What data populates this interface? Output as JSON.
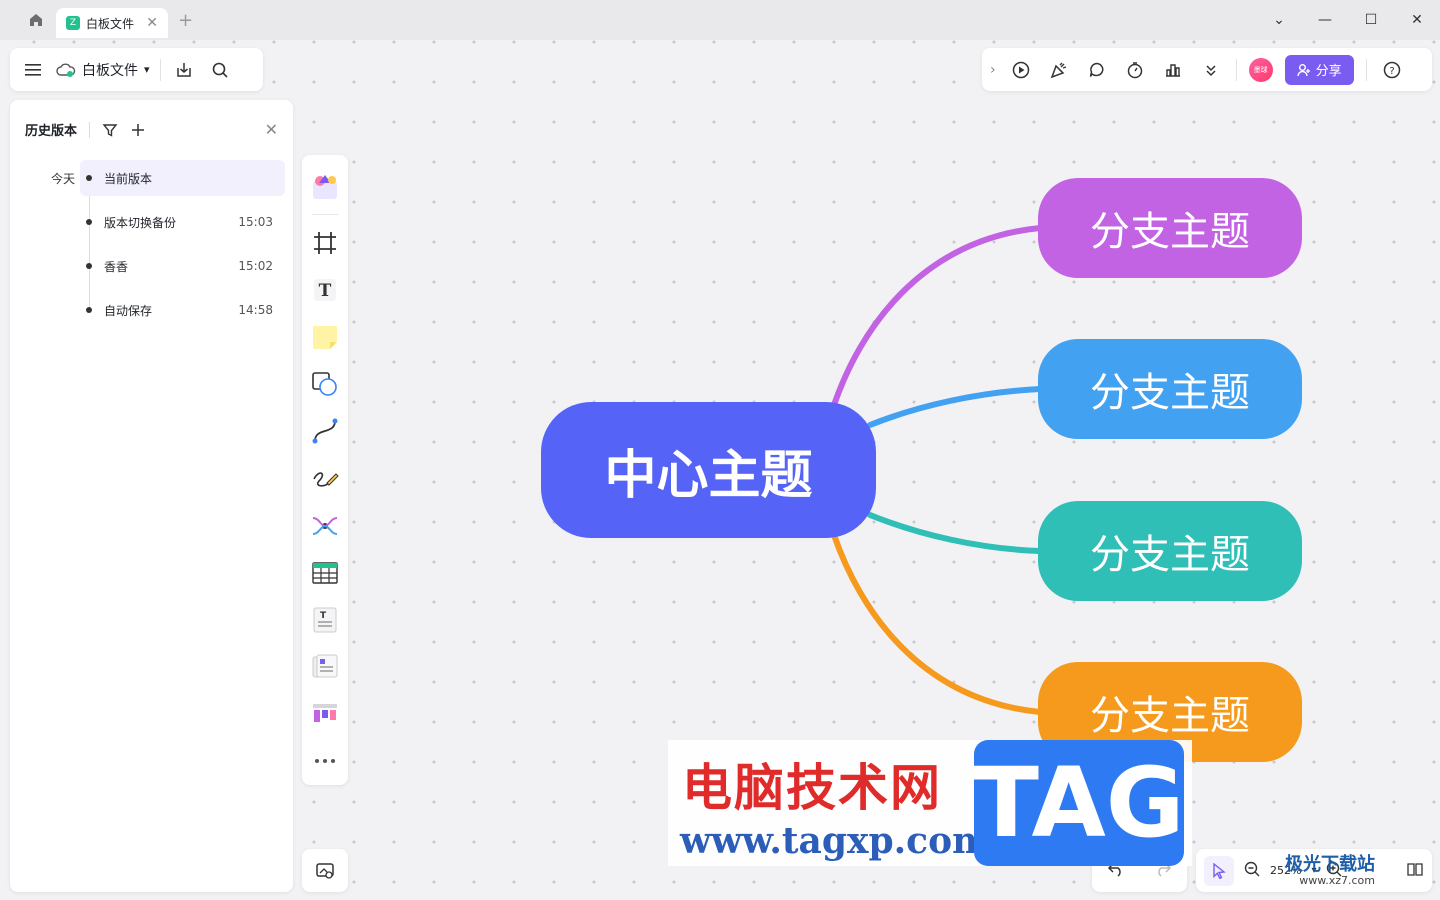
{
  "titlebar": {
    "tab_title": "白板文件",
    "tab_logo_text": "Z"
  },
  "toolbar_left": {
    "document_name": "白板文件"
  },
  "toolbar_right": {
    "avatar_text": "墨球",
    "share_label": "分享"
  },
  "history": {
    "title": "历史版本",
    "group_label": "今天",
    "items": [
      {
        "label": "当前版本",
        "time": ""
      },
      {
        "label": "版本切换备份",
        "time": "15:03"
      },
      {
        "label": "香香",
        "time": "15:02"
      },
      {
        "label": "自动保存",
        "time": "14:58"
      }
    ]
  },
  "zoom": {
    "level": "252%"
  },
  "mindmap": {
    "center": {
      "label": "中心主题",
      "color": "#5563f7"
    },
    "branches": [
      {
        "label": "分支主题",
        "color": "#c263e4"
      },
      {
        "label": "分支主题",
        "color": "#43a1f1"
      },
      {
        "label": "分支主题",
        "color": "#2fbfb7"
      },
      {
        "label": "分支主题",
        "color": "#f59a1c"
      }
    ]
  },
  "watermark": {
    "cn_text": "电脑技术网",
    "url": "www.tagxp.com",
    "tag": "TAG",
    "corner_text": "极光下载站",
    "corner_url": "www.xz7.com"
  },
  "colors": {
    "accent": "#7b5cf0",
    "canvas_bg": "#f2f2f5"
  }
}
